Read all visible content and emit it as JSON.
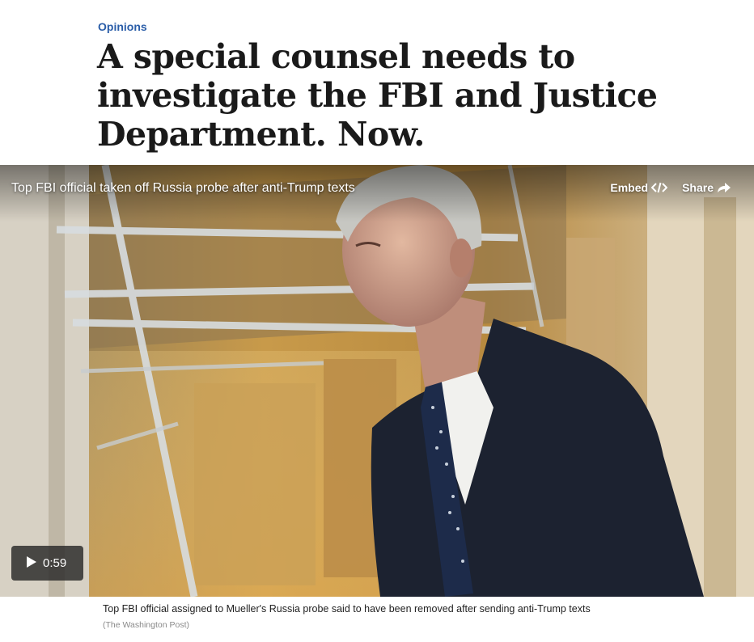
{
  "section": {
    "kicker": "Opinions"
  },
  "article": {
    "headline": "A special counsel needs to investigate the FBI and Justice Department. Now."
  },
  "video": {
    "title": "Top FBI official taken off Russia probe after anti-Trump texts",
    "embed_label": "Embed",
    "embed_icon": "code-icon",
    "share_label": "Share",
    "share_icon": "share-arrow-icon",
    "duration": "0:59",
    "play_icon": "play-icon"
  },
  "caption": {
    "text": "Top FBI official assigned to Mueller's Russia probe said to have been removed after sending anti-Trump texts",
    "credit": "(The Washington Post)"
  },
  "colors": {
    "kicker": "#2a5da8",
    "headline": "#1a1a1a"
  }
}
